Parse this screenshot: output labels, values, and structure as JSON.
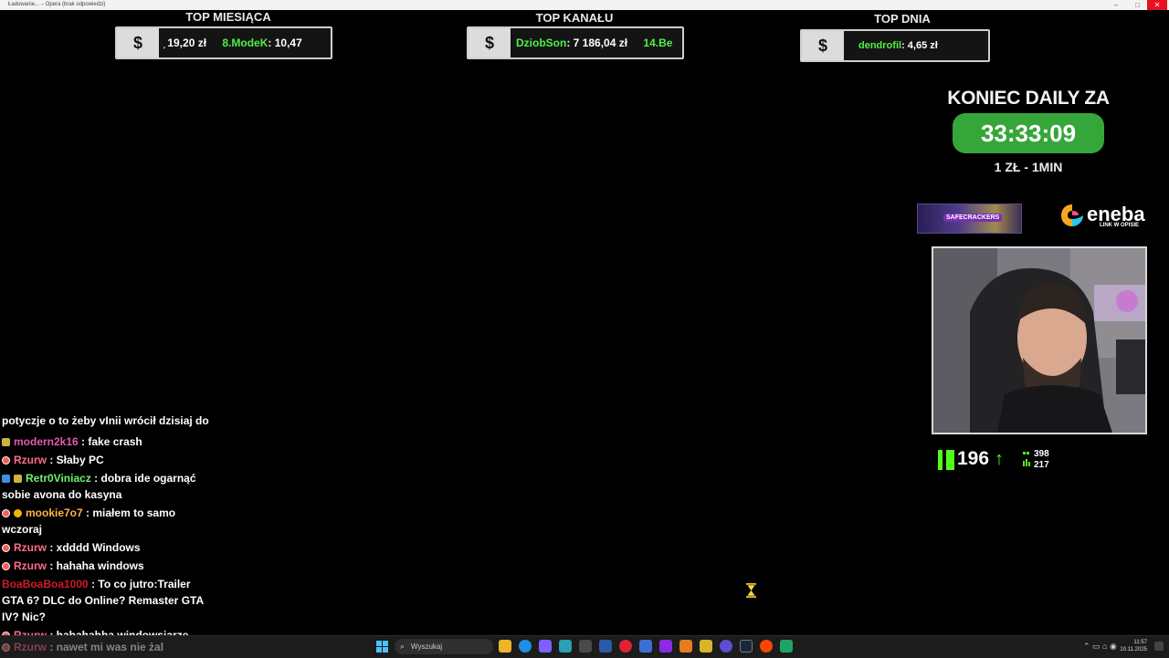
{
  "window": {
    "title": "Ładowanie... – Opera (brak odpowiedzi)",
    "controls": {
      "minimize": "–",
      "maximize": "□",
      "close": "✕"
    }
  },
  "leaderboards": [
    {
      "title": "TOP MIESIĄCA",
      "entries": [
        {
          "name": "",
          "value": "͕ 19,20 zł"
        },
        {
          "name": "8.ModeK",
          "value": ": 10,47"
        }
      ]
    },
    {
      "title": "TOP KANAŁU",
      "entries": [
        {
          "name": "DziobSon",
          "value": ": 7 186,04 zł"
        },
        {
          "name": "14.Be",
          "value": ""
        }
      ]
    },
    {
      "title": "TOP DNIA",
      "entries": [
        {
          "name": "dendrofil",
          "value": ": 4,65 zł"
        }
      ]
    }
  ],
  "dollar_symbol": "$",
  "countdown": {
    "title": "KONIEC DAILY ZA",
    "time": "33:33:09",
    "rate": "1 ZŁ - 1MIN"
  },
  "sponsors": {
    "safe_label": "SAFECRACKERS",
    "eneba": "eneba",
    "eneba_sub": "LINK W OPISIE"
  },
  "kick": {
    "followers": "196",
    "up_arrow": "↑",
    "stat_a": "398",
    "stat_b": "217"
  },
  "chat": [
    {
      "user": "",
      "color": "#ffffff",
      "text": "potyczje o to żeby vInii wrócił dzisiaj do waterpark",
      "badges": []
    },
    {
      "user": "modern2k16",
      "color": "#e05ab0",
      "text": ": fake crash",
      "badges": [
        "sq-green"
      ]
    },
    {
      "user": "Rzurw",
      "color": "#ff6b8a",
      "text": ": Słaby PC",
      "badges": [
        "red"
      ]
    },
    {
      "user": "Retr0Viniacz",
      "color": "#6df26d",
      "text": ": dobra ide ogarnąć sobie avona do kasyna",
      "badges": [
        "sq-blue",
        "sq-green"
      ]
    },
    {
      "user": "mookie7o7",
      "color": "#ffb347",
      "text": ": miałem to samo wczoraj",
      "badges": [
        "red",
        "gold"
      ]
    },
    {
      "user": "Rzurw",
      "color": "#ff6b8a",
      "text": ": xdddd Windows",
      "badges": [
        "red"
      ]
    },
    {
      "user": "Rzurw",
      "color": "#ff6b8a",
      "text": ": hahaha windows",
      "badges": [
        "red"
      ]
    },
    {
      "user": "BoaBoaBoa1000",
      "color": "#d11a2a",
      "text": ": To co jutro:Trailer GTA 6? DLC do Online? Remaster GTA IV? Nic?",
      "badges": []
    },
    {
      "user": "Rzurw",
      "color": "#ff6b8a",
      "text": ": hahahahha windowsiarze",
      "badges": [
        "red"
      ]
    },
    {
      "user": "Rzurw",
      "color": "#ff6b8a",
      "text": ": nawet mi was nie żal",
      "badges": [
        "red"
      ]
    }
  ],
  "taskbar": {
    "search_placeholder": "Wyszukaj",
    "clock_time": "11:57",
    "clock_date": "10.11.2025",
    "tray": "⌃  ▭  ⌂  ◉"
  },
  "cursor_icon": "hourglass-icon"
}
